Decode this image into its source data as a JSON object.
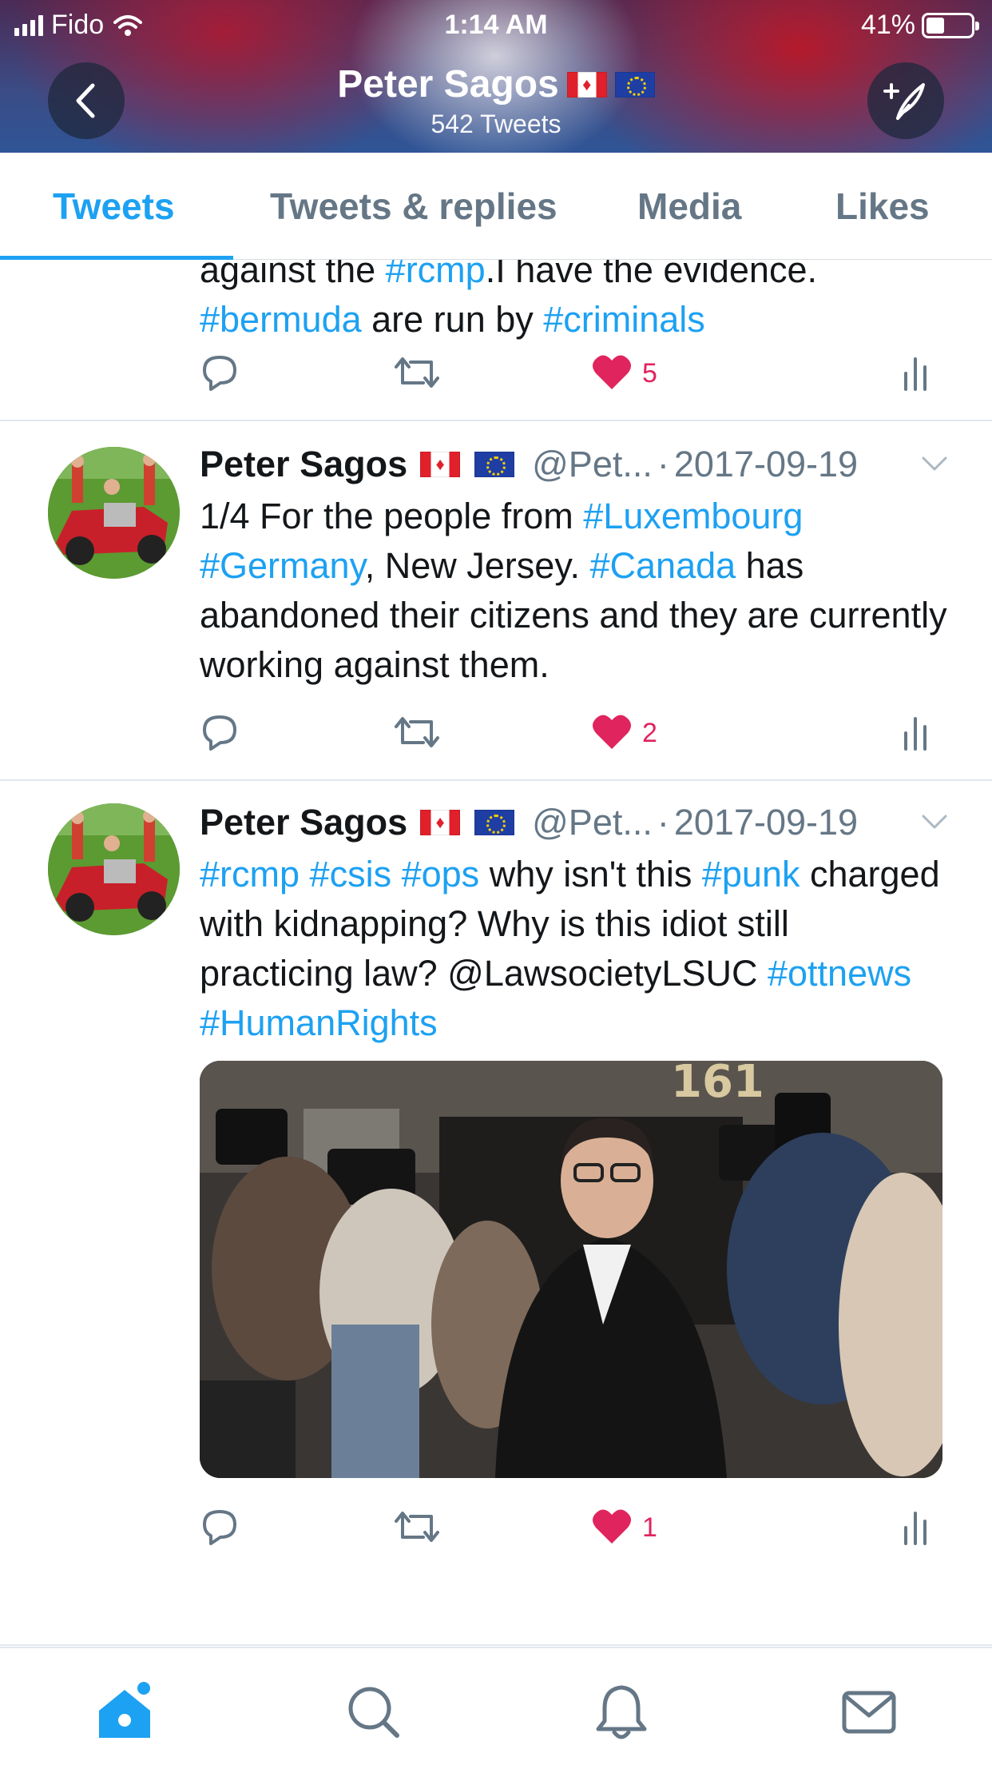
{
  "status_bar": {
    "carrier": "Fido",
    "time": "1:14 AM",
    "battery": "41%",
    "battery_level": 0.41
  },
  "header": {
    "name": "Peter Sagos",
    "tweet_count": "542 Tweets",
    "back_icon": "chevron-left-icon",
    "compose_icon": "compose-tweet-icon"
  },
  "tabs": [
    {
      "label": "Tweets",
      "active": true
    },
    {
      "label": "Tweets & replies",
      "active": false
    },
    {
      "label": "Media",
      "active": false
    },
    {
      "label": "Likes",
      "active": false
    }
  ],
  "tweets": [
    {
      "partial_line_1": [
        {
          "t": "against the "
        },
        {
          "t": "#rcmp",
          "tag": true
        },
        {
          "t": ".I have the evidence."
        }
      ],
      "partial_line_2": [
        {
          "t": "#bermuda",
          "tag": true
        },
        {
          "t": " are run by "
        },
        {
          "t": "#criminals",
          "tag": true
        }
      ],
      "likes": "5"
    },
    {
      "name": "Peter Sagos",
      "handle": "@Pet...",
      "date": "2017-09-19",
      "text": [
        {
          "t": "1/4 For the people from "
        },
        {
          "t": "#Luxembourg",
          "tag": true
        },
        {
          "t": " "
        },
        {
          "t": "#Germany",
          "tag": true
        },
        {
          "t": ", New Jersey. "
        },
        {
          "t": "#Canada",
          "tag": true
        },
        {
          "t": " has abandoned their citizens and they are currently working against them."
        }
      ],
      "likes": "2"
    },
    {
      "name": "Peter Sagos",
      "handle": "@Pet...",
      "date": "2017-09-19",
      "text": [
        {
          "t": "#rcmp",
          "tag": true
        },
        {
          "t": " "
        },
        {
          "t": "#csis",
          "tag": true
        },
        {
          "t": " "
        },
        {
          "t": "#ops",
          "tag": true
        },
        {
          "t": " why isn't this "
        },
        {
          "t": "#punk",
          "tag": true
        },
        {
          "t": " charged with kidnapping? Why is this idiot still practicing law? @LawsocietyLSUC "
        },
        {
          "t": "#ottnews",
          "tag": true
        },
        {
          "t": " "
        },
        {
          "t": "#HumanRights",
          "tag": true
        }
      ],
      "media_overlay_text": "161",
      "likes": "1"
    }
  ],
  "bottom_nav": [
    {
      "icon": "home-icon",
      "active": true
    },
    {
      "icon": "search-icon",
      "active": false
    },
    {
      "icon": "notifications-bell-icon",
      "active": false
    },
    {
      "icon": "messages-envelope-icon",
      "active": false
    }
  ],
  "colors": {
    "accent": "#1da1f2",
    "like": "#e0245e",
    "text": "#14171a",
    "muted": "#657786"
  }
}
